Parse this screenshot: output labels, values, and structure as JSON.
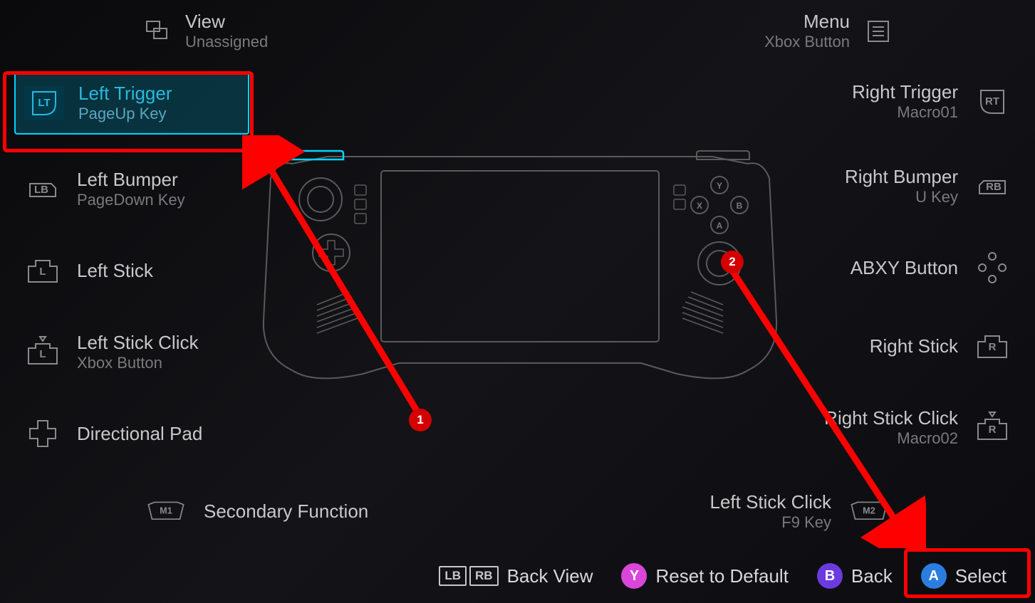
{
  "top": {
    "view": {
      "primary": "View",
      "secondary": "Unassigned"
    },
    "menu": {
      "primary": "Menu",
      "secondary": "Xbox Button"
    }
  },
  "left": [
    {
      "id": "left-trigger",
      "primary": "Left Trigger",
      "secondary": "PageUp Key",
      "icon_label": "LT",
      "selected": true
    },
    {
      "id": "left-bumper",
      "primary": "Left Bumper",
      "secondary": "PageDown Key",
      "icon_label": "LB"
    },
    {
      "id": "left-stick",
      "primary": "Left Stick",
      "secondary": "",
      "icon_label": "L"
    },
    {
      "id": "left-stick-click",
      "primary": "Left Stick Click",
      "secondary": "Xbox Button",
      "icon_label": "L"
    },
    {
      "id": "directional-pad",
      "primary": "Directional Pad",
      "secondary": "",
      "icon_label": ""
    }
  ],
  "right": [
    {
      "id": "right-trigger",
      "primary": "Right Trigger",
      "secondary": "Macro01",
      "icon_label": "RT"
    },
    {
      "id": "right-bumper",
      "primary": "Right Bumper",
      "secondary": "U Key",
      "icon_label": "RB"
    },
    {
      "id": "abxy-button",
      "primary": "ABXY Button",
      "secondary": "",
      "icon_label": ""
    },
    {
      "id": "right-stick",
      "primary": "Right Stick",
      "secondary": "",
      "icon_label": "R"
    },
    {
      "id": "right-stick-click",
      "primary": "Right Stick Click",
      "secondary": "Macro02",
      "icon_label": "R"
    }
  ],
  "bottom": {
    "m1": {
      "primary": "Secondary Function",
      "secondary": "",
      "icon_label": "M1"
    },
    "m2": {
      "primary": "Left Stick Click",
      "secondary": "F9 Key",
      "icon_label": "M2"
    }
  },
  "footer": {
    "back_view": "Back View",
    "reset": "Reset to Default",
    "back": "Back",
    "select": "Select",
    "lb": "LB",
    "rb": "RB",
    "y": "Y",
    "b": "B",
    "a": "A"
  },
  "annotations": {
    "marker1": "1",
    "marker2": "2"
  }
}
